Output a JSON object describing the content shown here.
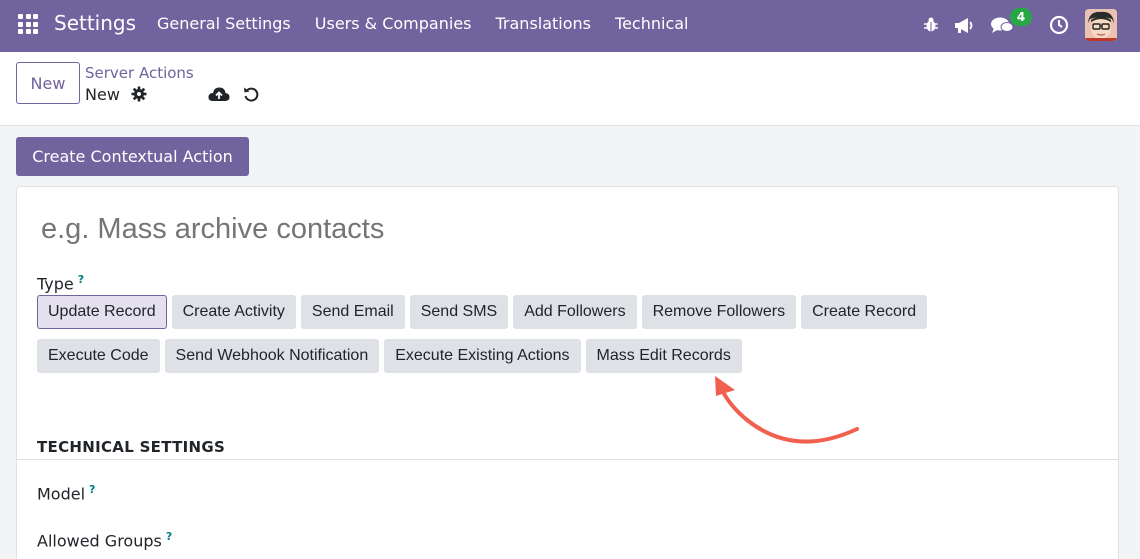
{
  "navbar": {
    "brand": "Settings",
    "menu": [
      "General Settings",
      "Users & Companies",
      "Translations",
      "Technical"
    ],
    "messages_badge": "4",
    "accent": "#71639e"
  },
  "control_panel": {
    "new_label": "New",
    "breadcrumb": "Server Actions",
    "record_name": "New"
  },
  "primary_action": "Create Contextual Action",
  "form": {
    "name_placeholder": "e.g. Mass archive contacts",
    "type_label": "Type",
    "help_mark": "?",
    "type_options_row1": [
      "Update Record",
      "Create Activity",
      "Send Email",
      "Send SMS",
      "Add Followers",
      "Remove Followers",
      "Create Record"
    ],
    "type_options_row2": [
      "Execute Code",
      "Send Webhook Notification",
      "Execute Existing Actions",
      "Mass Edit Records"
    ],
    "selected_type": "Update Record",
    "technical_settings_title": "TECHNICAL SETTINGS",
    "model_label": "Model",
    "allowed_groups_label": "Allowed Groups"
  },
  "icons": [
    "apps-icon",
    "bug-icon",
    "megaphone-icon",
    "chat-icon",
    "clock-icon",
    "avatar",
    "gear-icon",
    "cloud-upload-icon",
    "undo-icon",
    "annotation-arrow"
  ],
  "colors": {
    "annotation_arrow": "#f0604d",
    "help": "#017e84"
  }
}
